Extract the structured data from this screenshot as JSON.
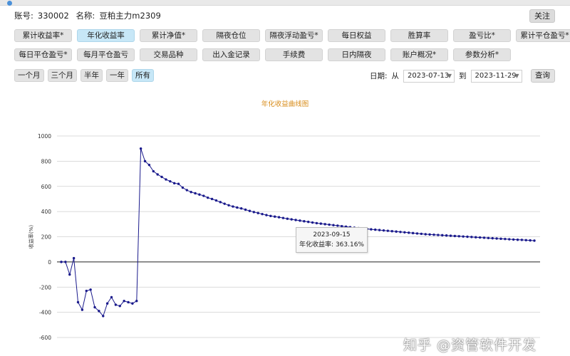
{
  "account": {
    "id_label": "账号:",
    "id_value": "330002",
    "name_label": "名称:",
    "name_value": "豆粕主力m2309"
  },
  "follow_label": "关注",
  "tabs_row1": [
    "累计收益率*",
    "年化收益率",
    "累计净值*",
    "隔夜仓位",
    "隔夜浮动盈亏*",
    "每日权益",
    "胜算率",
    "盈亏比*",
    "累计平仓盈亏*"
  ],
  "tabs_row2": [
    "每日平仓盈亏*",
    "每月平仓盈亏",
    "交易品种",
    "出入金记录",
    "手续费",
    "日内隔夜",
    "账户概况*",
    "参数分析*"
  ],
  "active_tab": "年化收益率",
  "ranges": [
    "一个月",
    "三个月",
    "半年",
    "一年",
    "所有"
  ],
  "active_range": "所有",
  "date": {
    "label": "日期:",
    "from_label": "从",
    "from": "2023-07-13",
    "to_label": "到",
    "to": "2023-11-29",
    "query_label": "查询"
  },
  "tooltip": {
    "date": "2023-09-15",
    "label": "年化收益率:",
    "value": "363.16%"
  },
  "watermark": "知乎 @资管软件开发",
  "colors": {
    "line": "#1a1a8c",
    "title": "#d88c1a",
    "active_tab": "#c7e7f7"
  },
  "chart_data": {
    "type": "line",
    "title": "年化收益曲线图",
    "ylabel": "收益率(%)",
    "xlabel": "",
    "ylim": [
      -600,
      1000
    ],
    "yticks": [
      -600,
      -400,
      -200,
      0,
      200,
      400,
      600,
      800,
      1000
    ],
    "grid": true,
    "series": [
      {
        "values": [
          0,
          0,
          -100,
          30,
          -320,
          -380,
          -230,
          -220,
          -360,
          -390,
          -430,
          -330,
          -280,
          -340,
          -350,
          -310,
          -320,
          -330,
          -310,
          900,
          800,
          770,
          720,
          695,
          675,
          655,
          640,
          625,
          620,
          590,
          570,
          555,
          545,
          535,
          525,
          510,
          500,
          488,
          475,
          462,
          450,
          440,
          432,
          425,
          415,
          405,
          396,
          388,
          380,
          372,
          365,
          360,
          355,
          349,
          343,
          338,
          333,
          328,
          323,
          318,
          313,
          308,
          304,
          300,
          296,
          292,
          288,
          284,
          280,
          276,
          272,
          268,
          265,
          262,
          259,
          256,
          253,
          250,
          247,
          244,
          241,
          238,
          235,
          232,
          229,
          226,
          223,
          220,
          218,
          216,
          214,
          212,
          210,
          208,
          206,
          204,
          202,
          200,
          198,
          196,
          194,
          192,
          190,
          188,
          186,
          184,
          182,
          180,
          178,
          176,
          175,
          173,
          171,
          169
        ]
      }
    ]
  }
}
